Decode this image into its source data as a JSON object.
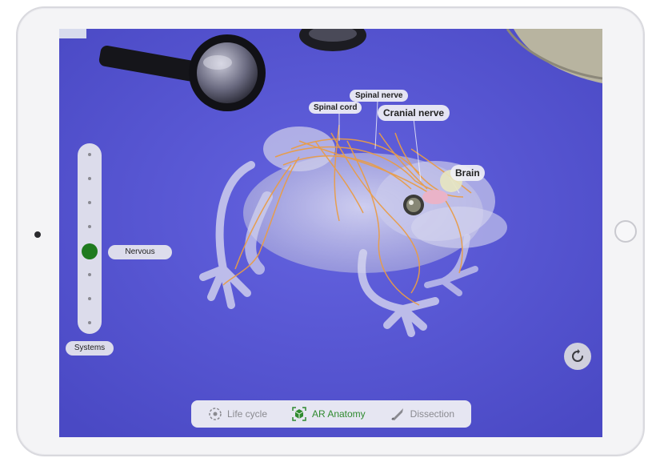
{
  "labels": {
    "spinal_cord": "Spinal cord",
    "spinal_nerve": "Spinal nerve",
    "cranial_nerve": "Cranial nerve",
    "brain": "Brain"
  },
  "systems_slider": {
    "title": "Systems",
    "selected": "Nervous",
    "stops": 8,
    "selected_index": 4
  },
  "tabs": [
    {
      "label": "Life cycle",
      "icon": "life-cycle-icon",
      "active": false
    },
    {
      "label": "AR Anatomy",
      "icon": "ar-cube-icon",
      "active": true
    },
    {
      "label": "Dissection",
      "icon": "scalpel-icon",
      "active": false
    }
  ],
  "colors": {
    "accent": "#2f8a2f",
    "table_surface": "#5a59d6",
    "nerve": "#f0a040",
    "brain": "#f2b8c8"
  }
}
